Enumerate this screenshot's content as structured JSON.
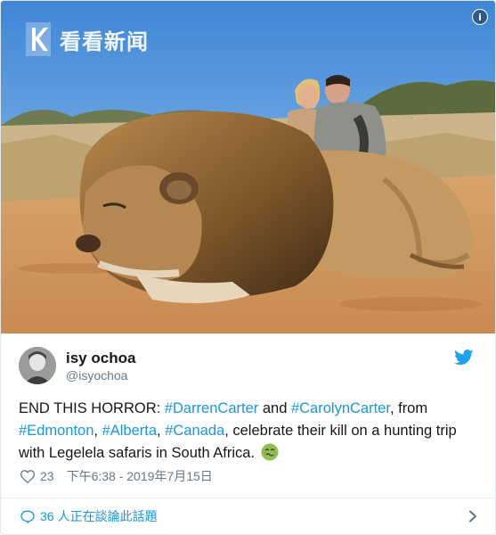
{
  "photo": {
    "watermark_text": "看看新闻",
    "info_icon": "info-icon",
    "info_glyph": "i"
  },
  "tweet": {
    "user": {
      "name": "isy ochoa",
      "handle": "@isyochoa"
    },
    "text": {
      "t1": "END THIS HORROR: ",
      "h1": "#DarrenCarter",
      "t2": " and  ",
      "h2": "#CarolynCarter",
      "t3": ", from ",
      "h3": "#Edmonton",
      "t4": ", ",
      "h4": "#Alberta",
      "t5": ", ",
      "h5": "#Canada",
      "t6": ", celebrate their kill on  a hunting trip with Legelela safaris in South Africa."
    },
    "likes": "23",
    "timestamp": "下午6:38 - 2019年7月15日",
    "footer": {
      "count": "36",
      "label": "人正在談論此話題"
    }
  },
  "colors": {
    "hashtag": "#1b95e0",
    "secondary_text": "#657786",
    "twitter_blue": "#1da1f2"
  }
}
